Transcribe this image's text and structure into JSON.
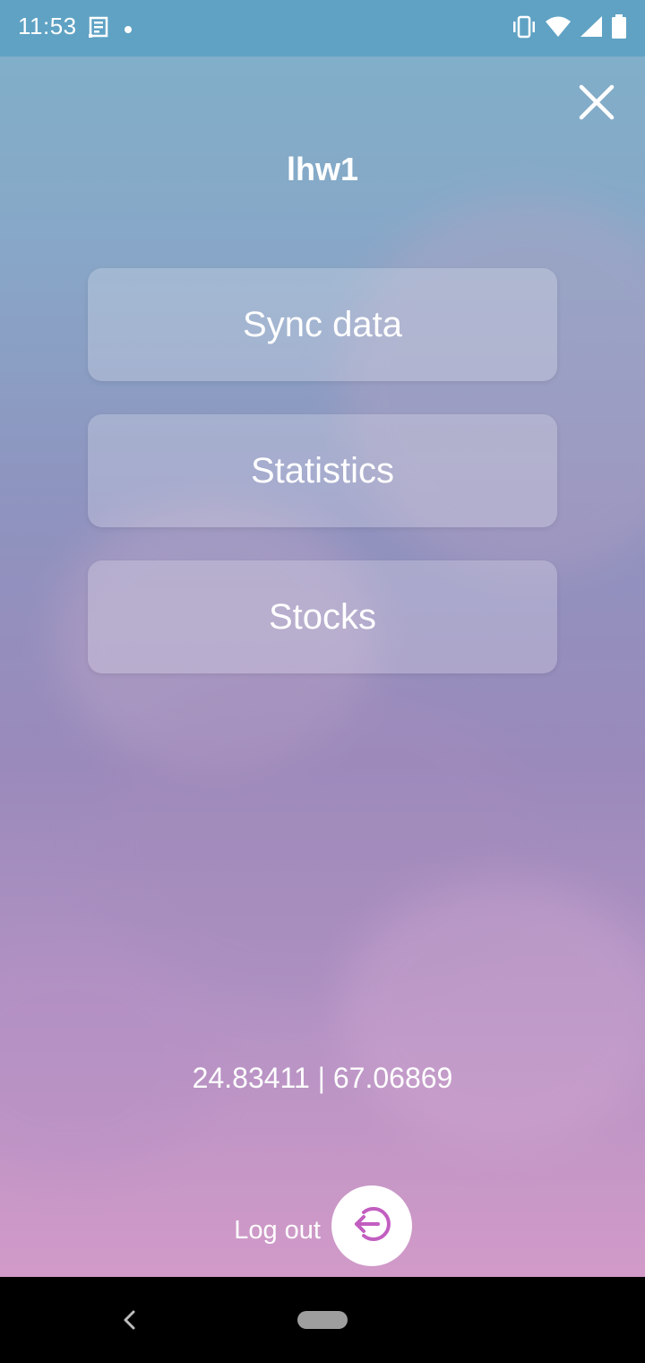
{
  "status_bar": {
    "time": "11:53",
    "left_icons": [
      "news-icon",
      "dot-icon"
    ],
    "right_icons": [
      "vibrate-icon",
      "wifi-icon",
      "signal-icon",
      "battery-icon"
    ]
  },
  "header": {
    "username": "lhw1",
    "close_icon": "close-icon"
  },
  "menu": {
    "items": [
      {
        "label": "Sync data"
      },
      {
        "label": "Statistics"
      },
      {
        "label": "Stocks"
      }
    ]
  },
  "location": {
    "coordinates": "24.83411 | 67.06869"
  },
  "logout": {
    "label": "Log out",
    "icon": "logout-icon",
    "icon_color": "#c25ec0"
  },
  "nav_bar": {
    "back_icon": "back-icon",
    "home_icon": "home-pill-icon"
  }
}
